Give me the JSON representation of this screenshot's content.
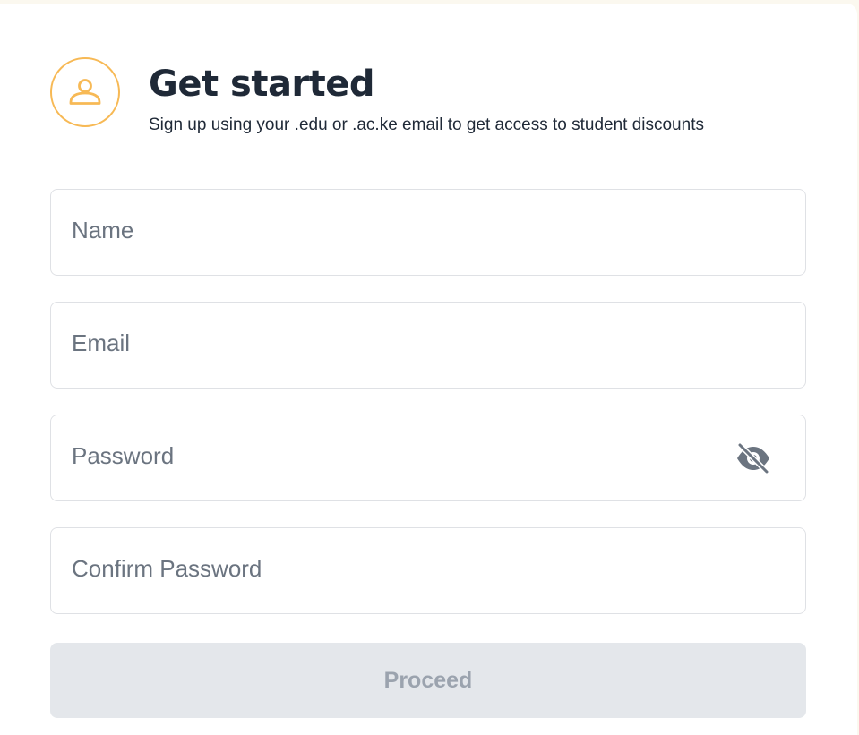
{
  "header": {
    "title": "Get started",
    "subtitle": "Sign up using your .edu or .ac.ke email to get access to student discounts",
    "icon": "user-icon",
    "accent_color": "#f7b955"
  },
  "form": {
    "name_placeholder": "Name",
    "email_placeholder": "Email",
    "password_placeholder": "Password",
    "confirm_password_placeholder": "Confirm Password",
    "password_toggle_icon": "eye-off-icon",
    "proceed_label": "Proceed",
    "proceed_disabled": true
  }
}
